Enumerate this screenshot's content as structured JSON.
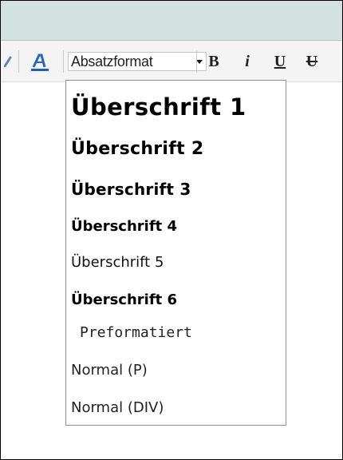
{
  "toolbar": {
    "format_select_value": "Absatzformat",
    "bold_label": "B",
    "italic_label": "i",
    "underline_label": "U",
    "strike_label": "U"
  },
  "dropdown": {
    "options": [
      "Überschrift 1",
      "Überschrift 2",
      "Überschrift 3",
      "Überschrift 4",
      "Überschrift 5",
      "Überschrift 6",
      "Preformatiert",
      "Normal (P)",
      "Normal (DIV)"
    ]
  },
  "icons": {
    "brush": "brush-icon",
    "font_color": "font-color-icon",
    "dropdown_arrow": "chevron-down-icon"
  },
  "colors": {
    "title_bar": "#d3e1df",
    "toolbar": "#f4f4f4",
    "font_color_accent": "#1d5fb8"
  }
}
